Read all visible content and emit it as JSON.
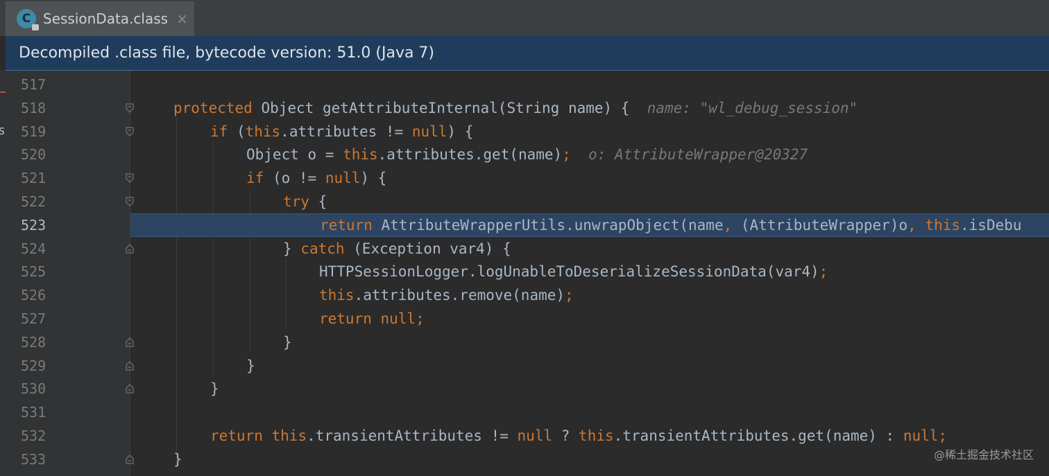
{
  "tab": {
    "icon": "C",
    "label": "SessionData.class",
    "close": "×"
  },
  "banner": {
    "text": "Decompiled .class file, bytecode version: 51.0 (Java 7)"
  },
  "left_strip": {
    "glyph": "s"
  },
  "colors": {
    "keyword": "#cc7832",
    "plain": "#a9b7c6",
    "hint": "#787878",
    "current_line": "#2d4462",
    "banner": "#1f3c5c"
  },
  "lines": [
    {
      "num": "517",
      "fold": "",
      "current": false,
      "segments": []
    },
    {
      "num": "518",
      "fold": "open",
      "current": false,
      "segments": [
        {
          "t": "kw",
          "v": "protected"
        },
        {
          "t": "plain",
          "v": " Object getAttributeInternal(String name) {  "
        },
        {
          "t": "hint",
          "v": "name: \"wl_debug_session\""
        }
      ]
    },
    {
      "num": "519",
      "fold": "open",
      "current": false,
      "segments": [
        {
          "t": "kw",
          "v": "if"
        },
        {
          "t": "plain",
          "v": " ("
        },
        {
          "t": "kw",
          "v": "this"
        },
        {
          "t": "plain",
          "v": ".attributes != "
        },
        {
          "t": "kw",
          "v": "null"
        },
        {
          "t": "plain",
          "v": ") {"
        }
      ]
    },
    {
      "num": "520",
      "fold": "",
      "current": false,
      "segments": [
        {
          "t": "plain",
          "v": "Object o = "
        },
        {
          "t": "kw",
          "v": "this"
        },
        {
          "t": "plain",
          "v": ".attributes.get(name)"
        },
        {
          "t": "kw",
          "v": ";"
        },
        {
          "t": "plain",
          "v": "  "
        },
        {
          "t": "hint",
          "v": "o: AttributeWrapper@20327"
        }
      ]
    },
    {
      "num": "521",
      "fold": "open",
      "current": false,
      "segments": [
        {
          "t": "kw",
          "v": "if"
        },
        {
          "t": "plain",
          "v": " (o != "
        },
        {
          "t": "kw",
          "v": "null"
        },
        {
          "t": "plain",
          "v": ") {"
        }
      ]
    },
    {
      "num": "522",
      "fold": "open",
      "current": false,
      "segments": [
        {
          "t": "kw",
          "v": "try"
        },
        {
          "t": "plain",
          "v": " {"
        }
      ]
    },
    {
      "num": "523",
      "fold": "",
      "current": true,
      "segments": [
        {
          "t": "kw",
          "v": "return"
        },
        {
          "t": "plain",
          "v": " AttributeWrapperUtils.unwrapObject(name"
        },
        {
          "t": "kw",
          "v": ","
        },
        {
          "t": "plain",
          "v": " (AttributeWrapper)o"
        },
        {
          "t": "kw",
          "v": ","
        },
        {
          "t": "plain",
          "v": " "
        },
        {
          "t": "kw",
          "v": "this"
        },
        {
          "t": "plain",
          "v": ".isDebu"
        }
      ]
    },
    {
      "num": "524",
      "fold": "close",
      "current": false,
      "segments": [
        {
          "t": "plain",
          "v": "} "
        },
        {
          "t": "kw",
          "v": "catch"
        },
        {
          "t": "plain",
          "v": " (Exception var4) {"
        }
      ]
    },
    {
      "num": "525",
      "fold": "",
      "current": false,
      "segments": [
        {
          "t": "plain",
          "v": "HTTPSessionLogger.logUnableToDeserializeSessionData(var4)"
        },
        {
          "t": "kw",
          "v": ";"
        }
      ]
    },
    {
      "num": "526",
      "fold": "",
      "current": false,
      "segments": [
        {
          "t": "kw",
          "v": "this"
        },
        {
          "t": "plain",
          "v": ".attributes.remove(name)"
        },
        {
          "t": "kw",
          "v": ";"
        }
      ]
    },
    {
      "num": "527",
      "fold": "",
      "current": false,
      "segments": [
        {
          "t": "kw",
          "v": "return null;"
        }
      ]
    },
    {
      "num": "528",
      "fold": "close",
      "current": false,
      "segments": [
        {
          "t": "plain",
          "v": "}"
        }
      ]
    },
    {
      "num": "529",
      "fold": "close",
      "current": false,
      "segments": [
        {
          "t": "plain",
          "v": "}"
        }
      ]
    },
    {
      "num": "530",
      "fold": "close",
      "current": false,
      "segments": [
        {
          "t": "plain",
          "v": "}"
        }
      ]
    },
    {
      "num": "531",
      "fold": "",
      "current": false,
      "segments": []
    },
    {
      "num": "532",
      "fold": "",
      "current": false,
      "segments": [
        {
          "t": "kw",
          "v": "return"
        },
        {
          "t": "plain",
          "v": " "
        },
        {
          "t": "kw",
          "v": "this"
        },
        {
          "t": "plain",
          "v": ".transientAttributes != "
        },
        {
          "t": "kw",
          "v": "null"
        },
        {
          "t": "plain",
          "v": " ? "
        },
        {
          "t": "kw",
          "v": "this"
        },
        {
          "t": "plain",
          "v": ".transientAttributes.get(name) : "
        },
        {
          "t": "kw",
          "v": "null;"
        }
      ]
    },
    {
      "num": "533",
      "fold": "close",
      "current": false,
      "segments": [
        {
          "t": "plain",
          "v": "}"
        }
      ]
    }
  ],
  "watermark": "@稀土掘金技术社区"
}
